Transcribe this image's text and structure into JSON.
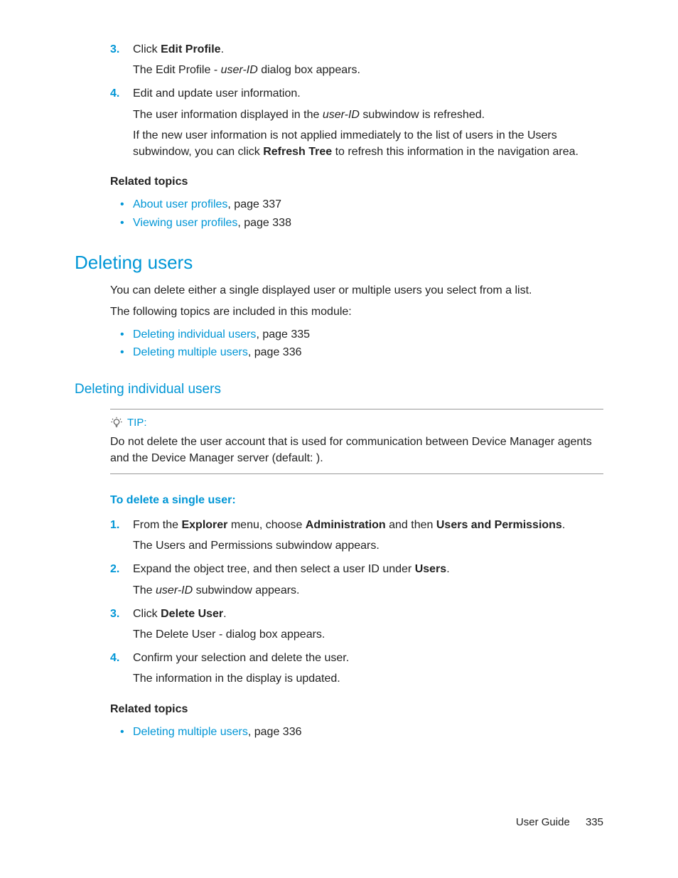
{
  "top_steps": [
    {
      "num": "3.",
      "text_pre": "Click ",
      "bold": "Edit Profile",
      "text_post": ".",
      "subs": [
        {
          "plain_pre": "The Edit Profile - ",
          "italic": "user-ID",
          "plain_post": " dialog box appears."
        }
      ]
    },
    {
      "num": "4.",
      "text_pre": "Edit and update user information.",
      "bold": "",
      "text_post": "",
      "subs": [
        {
          "plain_pre": "The user information displayed in the ",
          "italic": "user-ID",
          "plain_post": " subwindow is refreshed."
        },
        {
          "plain_pre": "If the new user information is not applied immediately to the list of users in the Users subwindow, you can click ",
          "bold": "Refresh Tree",
          "plain_post": " to refresh this information in the navigation area."
        }
      ]
    }
  ],
  "related1_heading": "Related topics",
  "related1": [
    {
      "link": "About user profiles",
      "rest": ", page 337"
    },
    {
      "link": "Viewing user profiles",
      "rest": ", page 338"
    }
  ],
  "h2": "Deleting users",
  "del_intro1": "You can delete either a single displayed user or multiple users you select from a list.",
  "del_intro2": "The following topics are included in this module:",
  "del_topics": [
    {
      "link": "Deleting individual users",
      "rest": ", page 335"
    },
    {
      "link": "Deleting multiple users",
      "rest": ", page 336"
    }
  ],
  "h3": "Deleting individual users",
  "tip_label": "TIP:",
  "tip_body": "Do not delete the user account that is used for communication between Device Manager agents and the Device Manager server (default:              ).",
  "proc_heading": "To delete a single user:",
  "proc_steps": [
    {
      "num": "1.",
      "html": "From the <strong>Explorer</strong> menu, choose <strong>Administration</strong> and then <strong>Users and Permissions</strong>.",
      "sub": "The Users and Permissions subwindow appears."
    },
    {
      "num": "2.",
      "html": "Expand the object tree, and then select a user ID under <strong>Users</strong>.",
      "sub_html": "The <span class=\"italic\">user-ID</span> subwindow appears."
    },
    {
      "num": "3.",
      "html": "Click <strong>Delete User</strong>.",
      "sub": "The Delete User -                 dialog box appears."
    },
    {
      "num": "4.",
      "html": "Confirm your selection and delete the user.",
      "sub": "The information in the display is updated."
    }
  ],
  "related2_heading": "Related topics",
  "related2": [
    {
      "link": "Deleting multiple users",
      "rest": ", page 336"
    }
  ],
  "footer_label": "User Guide",
  "footer_page": "335"
}
